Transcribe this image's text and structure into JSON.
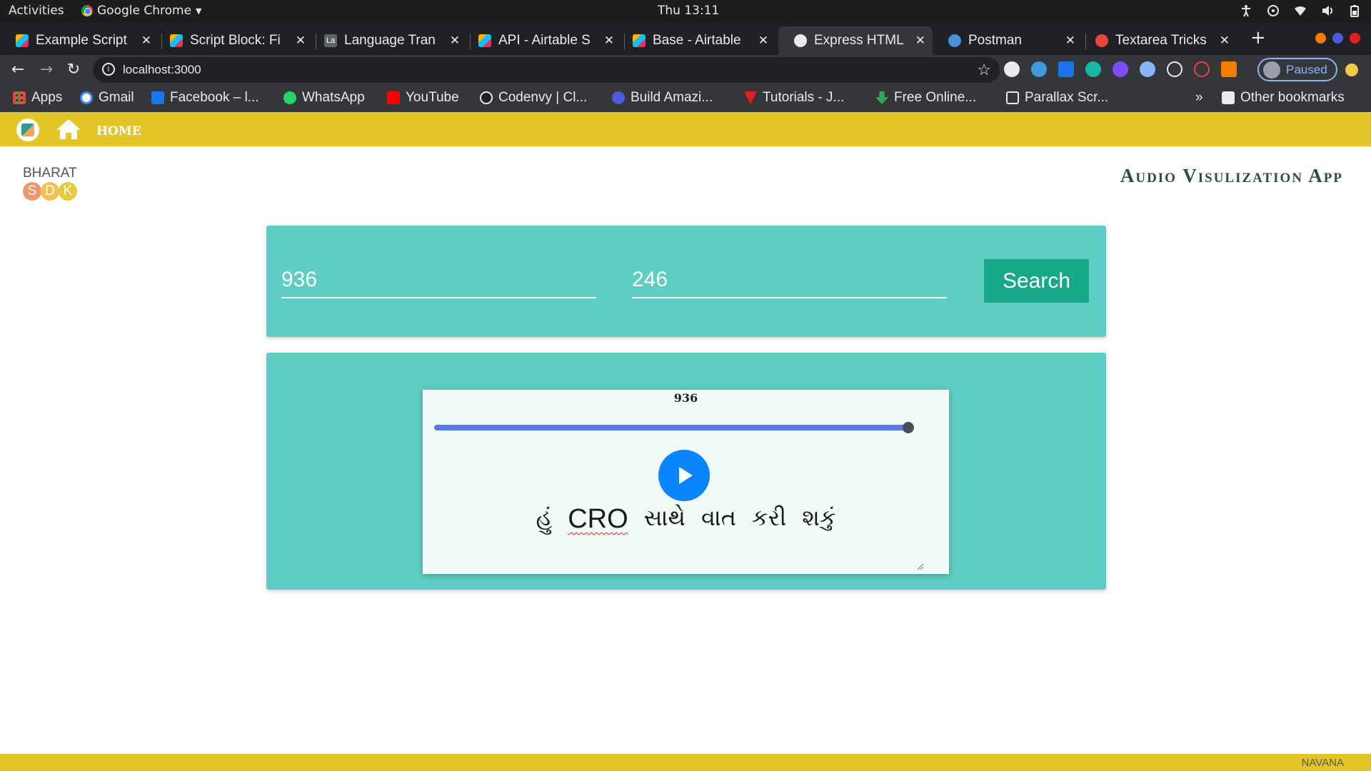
{
  "os": {
    "activities": "Activities",
    "app_name": "Google Chrome",
    "clock": "Thu 13:11"
  },
  "browser": {
    "tabs": [
      {
        "label": "Example Script",
        "favicon": "airtable-icon"
      },
      {
        "label": "Script Block: Fi",
        "favicon": "airtable-icon"
      },
      {
        "label": "Language Tran",
        "favicon": "la-icon"
      },
      {
        "label": "API - Airtable S",
        "favicon": "airtable-icon"
      },
      {
        "label": "Base - Airtable",
        "favicon": "airtable-icon"
      },
      {
        "label": "Express HTML",
        "favicon": "globe-icon",
        "active": true
      },
      {
        "label": "Postman",
        "favicon": "globe-icon"
      },
      {
        "label": "Textarea Tricks",
        "favicon": "codepen-icon"
      }
    ],
    "url": "localhost:3000",
    "profile_label": "Paused",
    "bookmarks": [
      {
        "label": "Apps"
      },
      {
        "label": "Gmail"
      },
      {
        "label": "Facebook – l..."
      },
      {
        "label": "WhatsApp"
      },
      {
        "label": "YouTube"
      },
      {
        "label": "Codenvy | Cl..."
      },
      {
        "label": "Build Amazi..."
      },
      {
        "label": "Tutorials - J..."
      },
      {
        "label": "Free Online..."
      },
      {
        "label": "Parallax Scr..."
      }
    ],
    "more_bookmarks": "»",
    "other_bookmarks": "Other bookmarks"
  },
  "page": {
    "nav": {
      "home_label": "HOME"
    },
    "brand": {
      "top": "BHARAT",
      "letters": [
        "S",
        "D",
        "K"
      ]
    },
    "app_title": "Audio Visulization App",
    "search": {
      "field1_value": "936",
      "field2_value": "246",
      "button_label": "Search"
    },
    "player": {
      "id_label": "936",
      "progress": 1.0,
      "transcript": [
        "હું",
        "CRO",
        "સાથે",
        "વાત",
        "કરી",
        "શકું"
      ]
    },
    "footer_brand": "NAVANA"
  },
  "colors": {
    "nav_yellow": "#e3c626",
    "card_teal": "#5ecdc3",
    "button_green": "#18a88a",
    "play_blue": "#0a84ff",
    "slider_blue": "#5b7be6"
  }
}
